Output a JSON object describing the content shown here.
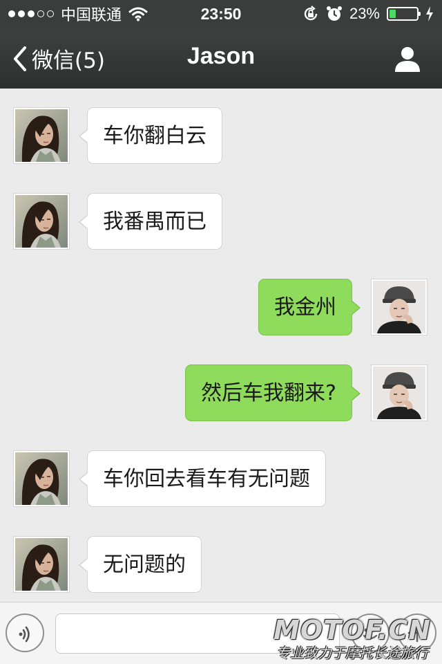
{
  "status_bar": {
    "carrier": "中国联通",
    "time": "23:50",
    "battery_percent": "23%",
    "battery_level": 0.23,
    "signal_bars_filled": 3,
    "signal_bars_total": 5,
    "icons": [
      "signal-dots-icon",
      "wifi-icon",
      "rotation-lock-icon",
      "alarm-icon",
      "battery-icon",
      "charging-bolt-icon"
    ]
  },
  "nav_bar": {
    "back_label": "微信(5)",
    "title": "Jason",
    "icons": [
      "back-chevron-icon",
      "person-icon"
    ]
  },
  "messages": [
    {
      "direction": "in",
      "sender": "contact",
      "text": "车你翻白云"
    },
    {
      "direction": "in",
      "sender": "contact",
      "text": "我番禺而已"
    },
    {
      "direction": "out",
      "sender": "me",
      "text": "我金州"
    },
    {
      "direction": "out",
      "sender": "me",
      "text": "然后车我翻来?"
    },
    {
      "direction": "in",
      "sender": "contact",
      "text": "车你回去看车有无问题"
    },
    {
      "direction": "in",
      "sender": "contact",
      "text": "无问题的"
    }
  ],
  "input_bar": {
    "text_value": "",
    "icons": [
      "voice-icon",
      "emoji-icon",
      "plus-icon"
    ]
  },
  "watermark": {
    "logo": "MOTOF.CN",
    "slogan": "专业致力于摩托长途旅行"
  },
  "colors": {
    "status_bar_bg": "#3b3d3c",
    "nav_bar_bg": "#333534",
    "chat_bg": "#ebebeb",
    "incoming_bubble": "#ffffff",
    "outgoing_bubble": "#8fdb5b",
    "battery_fill": "#4cd964"
  }
}
